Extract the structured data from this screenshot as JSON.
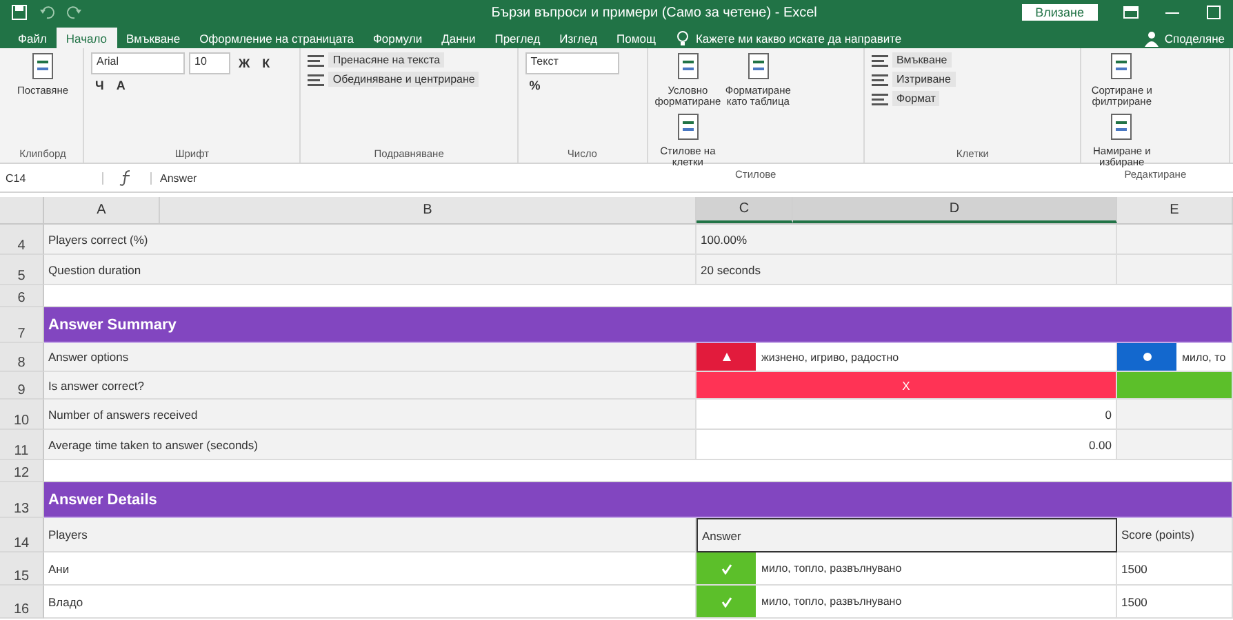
{
  "window": {
    "title": "Бързи въпроси и примери (Само за четене) - Excel",
    "sign_in": "Влизане"
  },
  "menu_tabs": [
    {
      "label": "Файл",
      "selected": false
    },
    {
      "label": "Начало",
      "selected": true
    },
    {
      "label": "Вмъкване",
      "selected": false
    },
    {
      "label": "Оформление на страницата",
      "selected": false
    },
    {
      "label": "Формули",
      "selected": false
    },
    {
      "label": "Данни",
      "selected": false
    },
    {
      "label": "Преглед",
      "selected": false
    },
    {
      "label": "Изглед",
      "selected": false
    },
    {
      "label": "Помощ",
      "selected": false
    }
  ],
  "tell_me": "Кажете ми какво искате да направите",
  "share": "Споделяне",
  "ribbon_groups": [
    {
      "label": "Клипборд",
      "controls": [
        {
          "kind": "big",
          "text": "Поставяне"
        }
      ]
    },
    {
      "label": "Шрифт",
      "controls": [
        {
          "kind": "combo",
          "text": "Arial"
        },
        {
          "kind": "spin",
          "text": "10"
        },
        {
          "kind": "glyph",
          "text": "Ж"
        },
        {
          "kind": "glyph",
          "text": "К"
        },
        {
          "kind": "glyph",
          "text": "Ч"
        },
        {
          "kind": "glyph",
          "text": "A"
        }
      ]
    },
    {
      "label": "Подравняване",
      "controls": [
        {
          "kind": "toggle",
          "text": "Пренасяне на текста"
        },
        {
          "kind": "toggle",
          "text": "Обединяване и центриране"
        }
      ]
    },
    {
      "label": "Число",
      "controls": [
        {
          "kind": "combo",
          "text": "Текст"
        },
        {
          "kind": "glyph",
          "text": "%"
        }
      ]
    },
    {
      "label": "Стилове",
      "controls": [
        {
          "kind": "big",
          "text": "Условно форматиране"
        },
        {
          "kind": "big",
          "text": "Форматиране като таблица"
        },
        {
          "kind": "big",
          "text": "Стилове на клетки"
        }
      ]
    },
    {
      "label": "Клетки",
      "controls": [
        {
          "kind": "toggle",
          "text": "Вмъкване"
        },
        {
          "kind": "toggle",
          "text": "Изтриване"
        },
        {
          "kind": "toggle",
          "text": "Формат"
        }
      ]
    },
    {
      "label": "Редактиране",
      "controls": [
        {
          "kind": "big",
          "text": "Сортиране и филтриране"
        },
        {
          "kind": "big",
          "text": "Намиране и избиране"
        }
      ]
    }
  ],
  "formula_bar": {
    "name_box": "C14",
    "formula": "Answer"
  },
  "columns": [
    "A",
    "B",
    "C",
    "D",
    "E"
  ],
  "rows": [
    {
      "number": "4",
      "kind": "pair",
      "label": "Players correct (%)",
      "value": "100.00%"
    },
    {
      "number": "5",
      "kind": "pair",
      "label": "Question duration",
      "value": "20 seconds"
    },
    {
      "number": "6",
      "kind": "blank"
    },
    {
      "number": "7",
      "kind": "section",
      "label": "Answer Summary"
    },
    {
      "number": "8",
      "kind": "options",
      "label": "Answer options",
      "options": [
        {
          "kind": "triangle",
          "color": "#e21b3c",
          "text": "жизнено, игриво, радостно"
        },
        {
          "kind": "circle",
          "color": "#1368ce",
          "text": "мило, то"
        }
      ]
    },
    {
      "number": "9",
      "kind": "correctness",
      "label": "Is answer correct?",
      "marks": [
        {
          "correct": false,
          "mark": "X"
        },
        {
          "correct": true
        }
      ]
    },
    {
      "number": "10",
      "kind": "numeric",
      "label": "Number of answers received",
      "value": "0"
    },
    {
      "number": "11",
      "kind": "numeric",
      "label": "Average time taken to answer (seconds)",
      "value": "0.00"
    },
    {
      "number": "12",
      "kind": "blank"
    },
    {
      "number": "13",
      "kind": "section",
      "label": "Answer Details"
    },
    {
      "number": "14",
      "kind": "header",
      "label": "Players",
      "answer_heading": "Answer",
      "score_heading": "Score (points)"
    },
    {
      "number": "15",
      "kind": "player",
      "label": "Ани",
      "correct": true,
      "answer": "мило, топло, развълнувано",
      "score": "1500"
    },
    {
      "number": "16",
      "kind": "player",
      "label": "Владо",
      "correct": true,
      "answer": "мило, топло, развълнувано",
      "score": "1500"
    }
  ]
}
